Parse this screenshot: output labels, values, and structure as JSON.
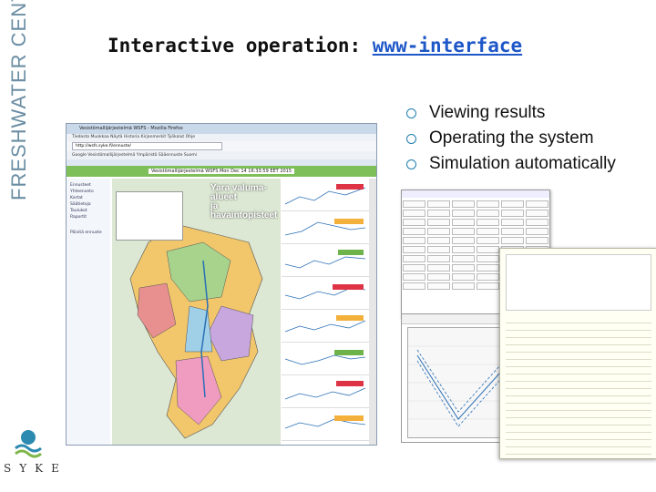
{
  "brand": {
    "side_text": "FRESHWATER CENTRE",
    "logo_text": "SYKE"
  },
  "slide": {
    "title_prefix": "Interactive operation: ",
    "title_link": "www-interface",
    "bullets": [
      "Viewing results",
      "Operating the system",
      "Simulation automatically"
    ]
  },
  "browser": {
    "window_title": "Vesistömallijärjestelmä WSFS - Mozilla Firefox",
    "menu": "Tiedosto  Muokkaa  Näytä  Historia  Kirjanmerkit  Työkalut  Ohje",
    "address": "http://wsfs.syke.fi/ennuste/",
    "bookmarks": "Google  Vesistömallijärjestelmä  Ympäristö  Sääennuste  Suomi",
    "page_header": "Vesistömallijärjestelmä WSFS Mon Dec 14 16:33:59 EET 2015",
    "map_title_line1": "Yara valuma-alueet",
    "map_title_line2": "ja havaintopisteet",
    "left_panel": [
      "Ennusteet",
      "Yhteenveto",
      "Kartat",
      "Säätietoja",
      "Taulukot",
      "Raportit",
      "Päivitä ennuste"
    ]
  },
  "colors": {
    "link_blue": "#1e57c8",
    "bullet_ring": "#1d7fb0",
    "brand_text": "#6b8ea3",
    "browser_header_green": "#7fbf5a"
  },
  "icons": {
    "bullet": "circle-ring-icon",
    "logo": "syke-wave-icon"
  }
}
